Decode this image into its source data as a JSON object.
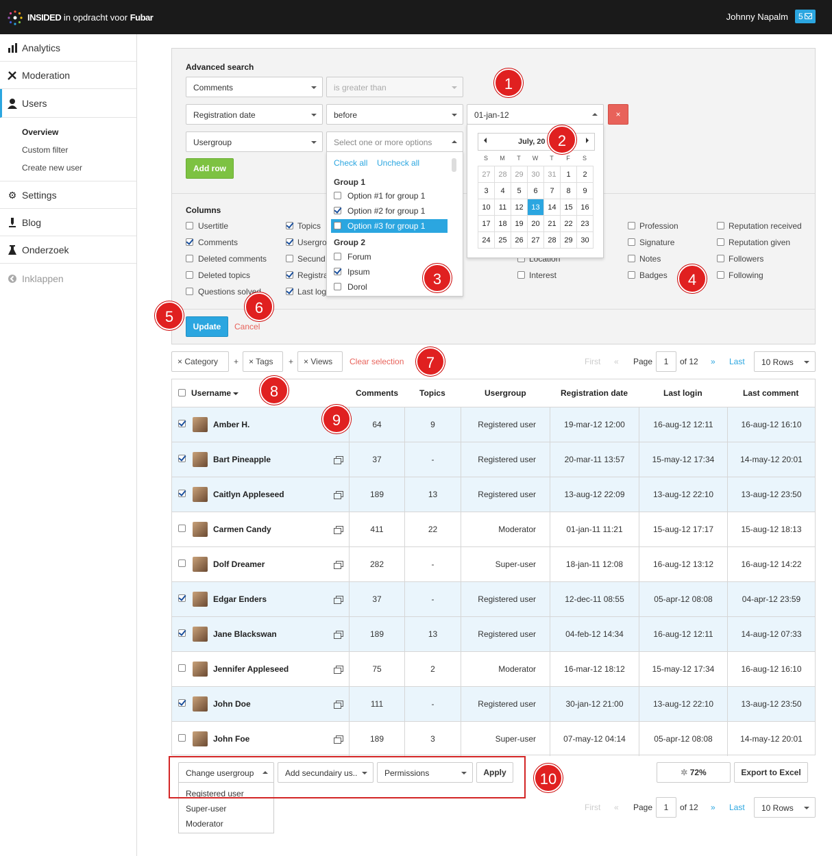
{
  "topbar": {
    "brand_name": "INSIDED",
    "brand_middle": "in opdracht voor",
    "brand_client": "Fubar",
    "user_name": "Johnny Napalm",
    "message_count": "5"
  },
  "sidebar": {
    "items": [
      {
        "label": "Analytics",
        "icon": "bar-chart-icon"
      },
      {
        "label": "Moderation",
        "icon": "tools-icon"
      },
      {
        "label": "Users",
        "icon": "user-icon"
      },
      {
        "label": "Settings",
        "icon": "gear-icon"
      },
      {
        "label": "Blog",
        "icon": "pen-icon"
      },
      {
        "label": "Onderzoek",
        "icon": "flask-icon"
      },
      {
        "label": "Inklappen",
        "icon": "collapse-icon"
      }
    ],
    "sub_items": [
      "Overview",
      "Custom filter",
      "Create new user"
    ]
  },
  "search": {
    "title": "Advanced search",
    "row1_field": "Comments",
    "row1_operator": "is greater than",
    "row2_field": "Registration date",
    "row2_operator": "before",
    "row2_value": "01-jan-12",
    "row3_field": "Usergroup",
    "row3_placeholder": "Select one or more options",
    "add_row": "Add row",
    "remove_symbol": "×"
  },
  "multiselect": {
    "check_all": "Check all",
    "uncheck_all": "Uncheck all",
    "group1": "Group 1",
    "options1": [
      {
        "label": "Option #1 for group 1",
        "checked": false
      },
      {
        "label": "Option #2 for group 1",
        "checked": true
      },
      {
        "label": "Option #3 for group 1",
        "checked": false
      }
    ],
    "group2": "Group 2",
    "options2": [
      {
        "label": "Forum",
        "checked": false
      },
      {
        "label": "Ipsum",
        "checked": true
      },
      {
        "label": "Dorol",
        "checked": false
      }
    ]
  },
  "calendar": {
    "month": "July, 20",
    "days_of_week": [
      "S",
      "M",
      "T",
      "W",
      "T",
      "F",
      "S"
    ],
    "weeks": [
      [
        "27",
        "28",
        "29",
        "30",
        "31",
        "1",
        "2"
      ],
      [
        "3",
        "4",
        "5",
        "6",
        "7",
        "8",
        "9"
      ],
      [
        "10",
        "11",
        "12",
        "13",
        "14",
        "15",
        "16"
      ],
      [
        "17",
        "18",
        "19",
        "20",
        "21",
        "22",
        "23"
      ],
      [
        "24",
        "25",
        "26",
        "27",
        "28",
        "29",
        "30"
      ]
    ],
    "selected": "13"
  },
  "columns": {
    "title": "Columns",
    "col1": [
      {
        "label": "Usertitle",
        "checked": false
      },
      {
        "label": "Comments",
        "checked": true
      },
      {
        "label": "Deleted comments",
        "checked": false
      },
      {
        "label": "Deleted topics",
        "checked": false
      },
      {
        "label": "Questions solved",
        "checked": false
      }
    ],
    "col2": [
      {
        "label": "Topics",
        "checked": true
      },
      {
        "label": "Usergro",
        "checked": true
      },
      {
        "label": "Secund",
        "checked": false
      },
      {
        "label": "Registra",
        "checked": true
      },
      {
        "label": "Last log",
        "checked": true
      }
    ],
    "col_loc": [
      {
        "label": "Location",
        "checked": false
      },
      {
        "label": "Interest",
        "checked": false
      }
    ],
    "col5": [
      {
        "label": "Profession",
        "checked": false
      },
      {
        "label": "Signature",
        "checked": false
      },
      {
        "label": "Notes",
        "checked": false
      },
      {
        "label": "Badges",
        "checked": false
      }
    ],
    "col6": [
      {
        "label": "Reputation received",
        "checked": false
      },
      {
        "label": "Reputation given",
        "checked": false
      },
      {
        "label": "Followers",
        "checked": false
      },
      {
        "label": "Following",
        "checked": false
      }
    ],
    "update": "Update",
    "cancel": "Cancel"
  },
  "filters": {
    "chips": [
      "Category",
      "Tags",
      "Views"
    ],
    "remove_symbol": "×",
    "plus": "+",
    "clear": "Clear selection"
  },
  "pager": {
    "first": "First",
    "prev": "«",
    "page_label": "Page",
    "page_value": "1",
    "of_label": "of 12",
    "next": "»",
    "last": "Last",
    "rows": "10 Rows"
  },
  "table": {
    "headers": {
      "username": "Username",
      "comments": "Comments",
      "topics": "Topics",
      "usergroup": "Usergroup",
      "registration": "Registration date",
      "last_login": "Last login",
      "last_comment": "Last comment"
    },
    "rows": [
      {
        "name": "Amber H.",
        "comments": "64",
        "topics": "9",
        "group": "Registered user",
        "reg": "19-mar-12 12:00",
        "login": "16-aug-12 12:11",
        "comment": "16-aug-12 16:10",
        "checked": true
      },
      {
        "name": "Bart Pineapple",
        "comments": "37",
        "topics": "-",
        "group": "Registered user",
        "reg": "20-mar-11 13:57",
        "login": "15-may-12 17:34",
        "comment": "14-may-12 20:01",
        "checked": true
      },
      {
        "name": "Caitlyn Appleseed",
        "comments": "189",
        "topics": "13",
        "group": "Registered user",
        "reg": "13-aug-12 22:09",
        "login": "13-aug-12 22:10",
        "comment": "13-aug-12 23:50",
        "checked": true
      },
      {
        "name": "Carmen Candy",
        "comments": "411",
        "topics": "22",
        "group": "Moderator",
        "reg": "01-jan-11 11:21",
        "login": "15-aug-12 17:17",
        "comment": "15-aug-12 18:13",
        "checked": false
      },
      {
        "name": "Dolf Dreamer",
        "comments": "282",
        "topics": "-",
        "group": "Super-user",
        "reg": "18-jan-11 12:08",
        "login": "16-aug-12 13:12",
        "comment": "16-aug-12 14:22",
        "checked": false
      },
      {
        "name": "Edgar Enders",
        "comments": "37",
        "topics": "-",
        "group": "Registered user",
        "reg": "12-dec-11 08:55",
        "login": "05-apr-12 08:08",
        "comment": "04-apr-12 23:59",
        "checked": true
      },
      {
        "name": "Jane Blackswan",
        "comments": "189",
        "topics": "13",
        "group": "Registered user",
        "reg": "04-feb-12 14:34",
        "login": "16-aug-12 12:11",
        "comment": "14-aug-12 07:33",
        "checked": true
      },
      {
        "name": "Jennifer Appleseed",
        "comments": "75",
        "topics": "2",
        "group": "Moderator",
        "reg": "16-mar-12 18:12",
        "login": "15-may-12 17:34",
        "comment": "16-aug-12 16:10",
        "checked": false
      },
      {
        "name": "John Doe",
        "comments": "111",
        "topics": "-",
        "group": "Registered user",
        "reg": "30-jan-12 21:00",
        "login": "13-aug-12 22:10",
        "comment": "13-aug-12 23:50",
        "checked": true
      },
      {
        "name": "John Foe",
        "comments": "189",
        "topics": "3",
        "group": "Super-user",
        "reg": "07-may-12 04:14",
        "login": "05-apr-12 08:08",
        "comment": "14-may-12 20:01",
        "checked": false
      }
    ]
  },
  "bulk": {
    "change_group": "Change usergroup",
    "add_secondary": "Add secundairy us..",
    "permissions": "Permissions",
    "apply": "Apply",
    "options": [
      "Registered user",
      "Super-user",
      "Moderator"
    ],
    "progress": "72%",
    "export": "Export to Excel"
  },
  "annotations": [
    "1",
    "2",
    "3",
    "4",
    "5",
    "6",
    "7",
    "8",
    "9",
    "10"
  ],
  "colors": {
    "accent": "#2ba6e0",
    "green": "#7dc242",
    "red": "#e02020",
    "row_selected": "#eaf5fc"
  }
}
